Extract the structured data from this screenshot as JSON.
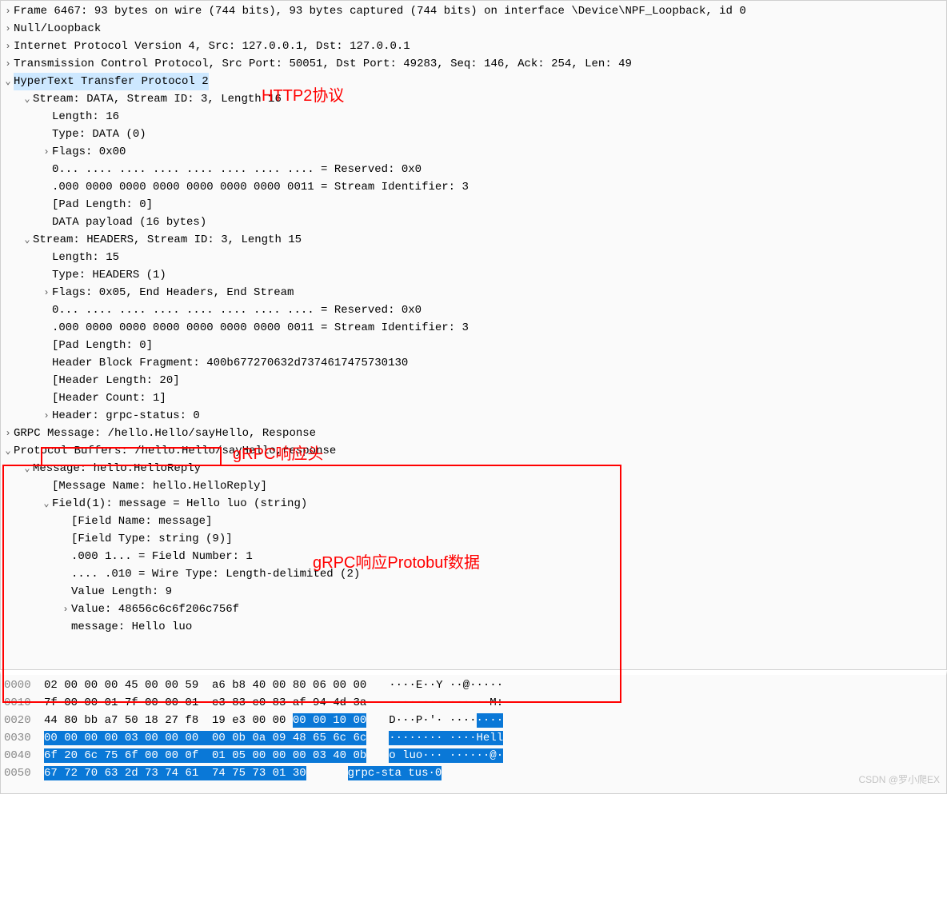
{
  "tree": {
    "frame": "Frame 6467: 93 bytes on wire (744 bits), 93 bytes captured (744 bits) on interface \\Device\\NPF_Loopback, id 0",
    "null_loop": "Null/Loopback",
    "ipv4": "Internet Protocol Version 4, Src: 127.0.0.1, Dst: 127.0.0.1",
    "tcp": "Transmission Control Protocol, Src Port: 50051, Dst Port: 49283, Seq: 146, Ack: 254, Len: 49",
    "http2": "HyperText Transfer Protocol 2",
    "stream_data": "Stream: DATA, Stream ID: 3, Length 16",
    "sd_length": "Length: 16",
    "sd_type": "Type: DATA (0)",
    "sd_flags": "Flags: 0x00",
    "sd_reserved": "0... .... .... .... .... .... .... .... = Reserved: 0x0",
    "sd_streamid": ".000 0000 0000 0000 0000 0000 0000 0011 = Stream Identifier: 3",
    "sd_padlen": "[Pad Length: 0]",
    "sd_payload": "DATA payload (16 bytes)",
    "stream_headers": "Stream: HEADERS, Stream ID: 3, Length 15",
    "sh_length": "Length: 15",
    "sh_type": "Type: HEADERS (1)",
    "sh_flags": "Flags: 0x05, End Headers, End Stream",
    "sh_reserved": "0... .... .... .... .... .... .... .... = Reserved: 0x0",
    "sh_streamid": ".000 0000 0000 0000 0000 0000 0000 0011 = Stream Identifier: 3",
    "sh_padlen": "[Pad Length: 0]",
    "sh_hblock": "Header Block Fragment: 400b677270632d7374617475730130",
    "sh_hlen": "[Header Length: 20]",
    "sh_hcount": "[Header Count: 1]",
    "sh_header": "Header: grpc-status: 0",
    "grpc_msg": "GRPC Message: /hello.Hello/sayHello, Response",
    "protobuf": "Protocol Buffers: /hello.Hello/sayHello,response",
    "pb_message": "Message: hello.HelloReply",
    "pb_msgname": "[Message Name: hello.HelloReply]",
    "pb_field": "Field(1): message = Hello luo (string)",
    "pb_fieldname": "[Field Name: message]",
    "pb_fieldtype": "[Field Type: string (9)]",
    "pb_fieldnum": ".000 1... = Field Number: 1",
    "pb_wiretype": ".... .010 = Wire Type: Length-delimited (2)",
    "pb_valuelen": "Value Length: 9",
    "pb_value": "Value: 48656c6c6f206c756f",
    "pb_msg": "message: Hello luo"
  },
  "annotations": {
    "http2": "HTTP2协议",
    "grpc_header": "gRPC响应头",
    "grpc_protobuf": "gRPC响应Protobuf数据"
  },
  "hex": {
    "rows": [
      {
        "off": "0000",
        "b": "02 00 00 00 45 00 00 59  a6 b8 40 00 80 06 00 00",
        "a": "····E··Y ··@·····"
      },
      {
        "off": "0010",
        "b": "7f 00 00 01 7f 00 00 01  c3 83 c0 83 af 94 4d 3a",
        "a": "········ ······M:"
      },
      {
        "off": "0020",
        "b1": "44 80 bb a7 50 18 27 f8  19 e3 00 00 ",
        "b2hl": "00 00 10 00",
        "a1": "D···P·'· ····",
        "a2hl": "····"
      },
      {
        "off": "0030",
        "b2hl": "00 00 00 00 03 00 00 00  00 0b 0a 09 48 65 6c 6c",
        "a2hl": "········ ····Hell"
      },
      {
        "off": "0040",
        "b2hl": "6f 20 6c 75 6f 00 00 0f  01 05 00 00 00 03 40 0b",
        "a2hl": "o luo··· ······@·"
      },
      {
        "off": "0050",
        "b2hl": "67 72 70 63 2d 73 74 61  74 75 73 01 30",
        "a2hl": "grpc-sta tus·0"
      }
    ]
  },
  "watermark": "CSDN @罗小爬EX"
}
